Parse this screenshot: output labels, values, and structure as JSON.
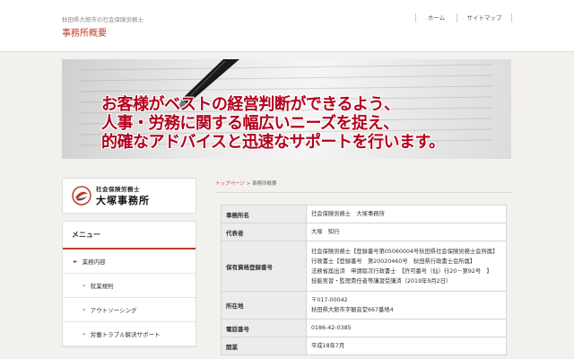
{
  "header": {
    "site_description": "秋田県大館市の社会保険労務士",
    "page_title": "事務所概要",
    "nav": [
      {
        "label": "ホーム"
      },
      {
        "label": "サイトマップ"
      }
    ]
  },
  "hero": {
    "lines": [
      "お客様がベストの経営判断ができるよう、",
      "人事・労務に関する幅広いニーズを捉え、",
      "的確なアドバイスと迅速なサポートを行います。"
    ]
  },
  "sidebar": {
    "logo": {
      "sub": "社会保険労務士",
      "name": "大塚事務所"
    },
    "menu_title": "メニュー",
    "items": [
      {
        "label": "業務内容"
      },
      {
        "label": "就業規則"
      },
      {
        "label": "アウトソーシング"
      },
      {
        "label": "労働トラブル解決サポート"
      }
    ]
  },
  "breadcrumb": {
    "home": "トップページ",
    "separator": " > ",
    "current": "事務所概要"
  },
  "info_table": [
    {
      "label": "事務所名",
      "lines": [
        "社会保険労務士　大塚事務所"
      ]
    },
    {
      "label": "代表者",
      "lines": [
        "大塚　知行"
      ]
    },
    {
      "label": "保有資格登録番号",
      "lines": [
        "社会保険労務士【登録番号第05060004号秋田県社会保険労務士会所属】",
        "行政書士【登録番号　第20020460号　秋田県行政書士会所属】",
        "法務省届出済　申請取次行政書士　【許可番号（仙）行20－第92号　】",
        "技能実習・監理責任者等講習受講済（2019年9月2日）"
      ]
    },
    {
      "label": "所在地",
      "lines": [
        "〒017-00042",
        "秋田県大館市字観音堂667番地4"
      ]
    },
    {
      "label": "電話番号",
      "lines": [
        "0186-42-0385"
      ]
    },
    {
      "label": "開業",
      "lines": [
        "平成18年7月"
      ]
    }
  ],
  "colors": {
    "accent": "#c0392b",
    "hero_text": "#b3001b"
  }
}
